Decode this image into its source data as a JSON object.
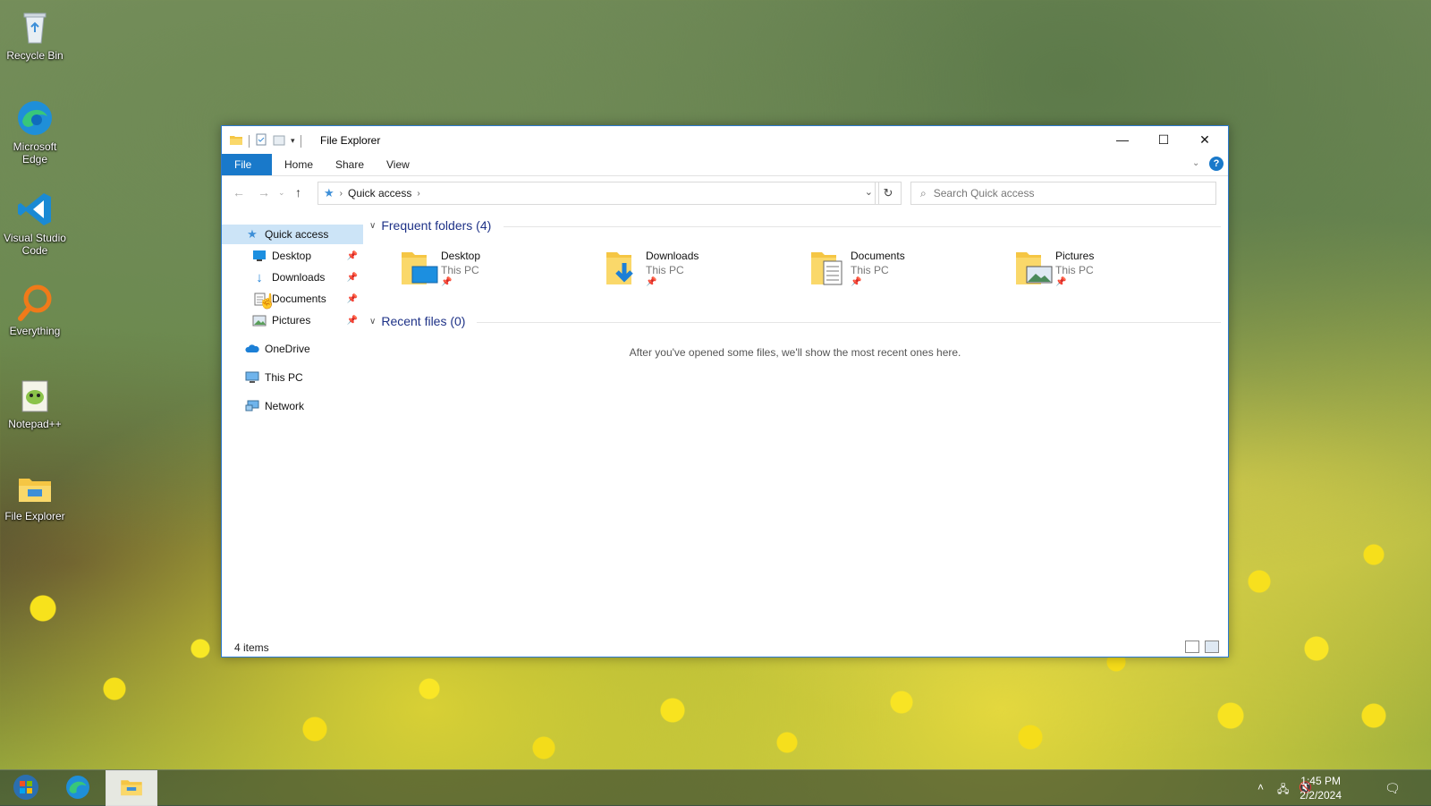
{
  "desktop": {
    "icons": [
      {
        "label": "Recycle Bin"
      },
      {
        "label": "Microsoft Edge"
      },
      {
        "label": "Visual Studio Code"
      },
      {
        "label": "Everything"
      },
      {
        "label": "Notepad++"
      },
      {
        "label": "File Explorer"
      }
    ]
  },
  "window": {
    "title": "File Explorer",
    "tabs": {
      "file": "File",
      "home": "Home",
      "share": "Share",
      "view": "View"
    },
    "address": {
      "root": "Quick access"
    },
    "search": {
      "placeholder": "Search Quick access"
    },
    "nav": {
      "quick_access": "Quick access",
      "desktop": "Desktop",
      "downloads": "Downloads",
      "documents": "Documents",
      "pictures": "Pictures",
      "onedrive": "OneDrive",
      "this_pc": "This PC",
      "network": "Network"
    },
    "frequent": {
      "heading": "Frequent folders (4)",
      "folders": [
        {
          "name": "Desktop",
          "location": "This PC"
        },
        {
          "name": "Downloads",
          "location": "This PC"
        },
        {
          "name": "Documents",
          "location": "This PC"
        },
        {
          "name": "Pictures",
          "location": "This PC"
        }
      ]
    },
    "recent": {
      "heading": "Recent files (0)",
      "empty_message": "After you've opened some files, we'll show the most recent ones here."
    },
    "status": {
      "count": "4 items"
    }
  },
  "taskbar": {
    "time": "1:45 PM",
    "date": "2/2/2024"
  },
  "colors": {
    "accent": "#1979ca",
    "selection": "#cce4f7",
    "heading": "#1e3287"
  }
}
